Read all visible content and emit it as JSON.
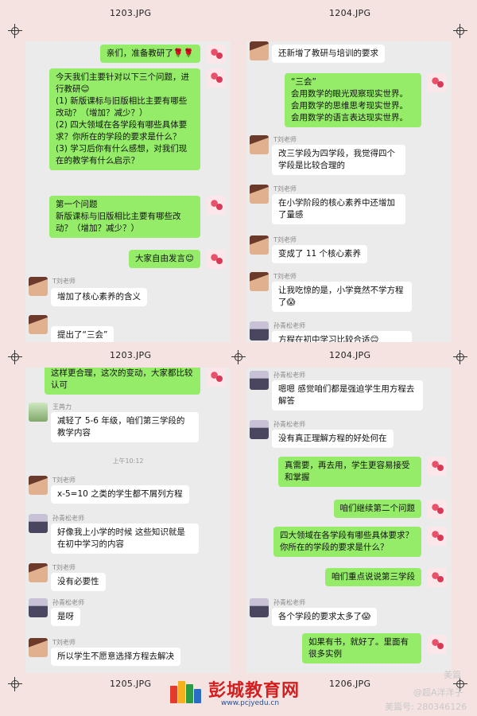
{
  "captions": {
    "tl": "1203.JPG",
    "tr": "1204.JPG",
    "bl": "1205.JPG",
    "br": "1206.JPG",
    "ml": "1203.JPG",
    "mr": "1204.JPG"
  },
  "names": {
    "liu": "T刘老师",
    "sun": "孙青松老师",
    "wang": "王苒力"
  },
  "p1": {
    "m1": "亲们，准备教研了🌹🌹",
    "m2": "今天我们主要针对以下三个问题，进行教研😊\n(1) 新版课标与旧版相比主要有哪些改动？（增加？减少？）\n(2) 四大领域在各学段有哪些具体要求？你所在的学段的要求是什么？\n(3) 学习后你有什么感想，对我们现在的教学有什么启示？",
    "m3": "第一个问题\n新版课标与旧版相比主要有哪些改动？（增加？减少？）",
    "m4": "大家自由发言😊",
    "m5": "增加了核心素养的含义",
    "m6": "提出了“三会”"
  },
  "p2": {
    "m1": "还新增了教研与培训的要求",
    "m2": "“三会”\n会用数学的眼光观察现实世界。\n会用数学的思维思考现实世界。\n会用数学的语言表达现实世界。",
    "m3": "改三学段为四学段，我觉得四个学段是比较合理的",
    "m4": "在小学阶段的核心素养中还增加了量感",
    "m5": "变成了 11 个核心素养",
    "m6": "让我吃惊的是，小学竟然不学方程了😱",
    "m7": "方程在初中学习比较合适😊"
  },
  "p3": {
    "m1": "这样更合理，这次的变动，大家都比较认可",
    "m2": "减轻了 5-6 年级，咱们第三学段的教学内容",
    "time": "上午10:12",
    "m3": "x-5=10 之类的学生都不屑列方程",
    "m4": "好像我上小学的时候 这些知识就是在初中学习的内容",
    "m5": "没有必要性",
    "m6": "是呀",
    "m7": "所以学生不愿意选择方程去解决"
  },
  "p4": {
    "m1": "嗯嗯 感觉咱们都是强迫学生用方程去解答",
    "m2": "没有真正理解方程的好处何在",
    "m3": "真需要，再去用，学生更容易接受和掌握",
    "m4": "咱们继续第二个问题",
    "m5": "四大领域在各学段有哪些具体要求？你所在的学段的要求是什么？",
    "m6": "咱们重点说说第三学段",
    "m7": "各个学段的要求太多了😱",
    "m8": "如果有书，就好了。里面有很多实例"
  },
  "brand": {
    "name": "彭城教育网",
    "url": "www.pcjyedu.cn"
  },
  "watermark": {
    "a": "美篇",
    "b": "@超A洋洋子",
    "c": "美篇号: 280346126"
  }
}
